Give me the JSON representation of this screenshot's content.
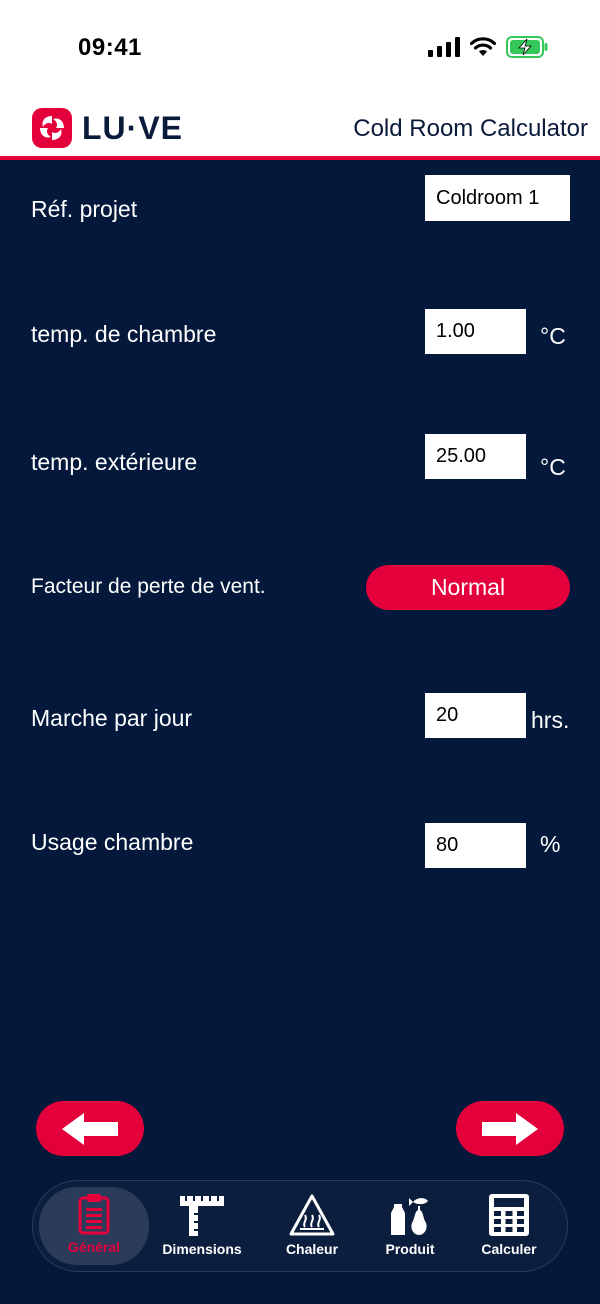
{
  "status": {
    "time": "09:41"
  },
  "header": {
    "brand": "LU·VE",
    "title": "Cold Room Calculator"
  },
  "form": {
    "project_ref": {
      "label": "Réf. projet",
      "value": "Coldroom 1"
    },
    "room_temp": {
      "label": "temp. de chambre",
      "value": "1.00",
      "unit": "°C"
    },
    "ext_temp": {
      "label": "temp. extérieure",
      "value": "25.00",
      "unit": "°C"
    },
    "vent_loss": {
      "label": "Facteur de perte de vent.",
      "value": "Normal"
    },
    "run_per_day": {
      "label": "Marche par jour",
      "value": "20",
      "unit": "hrs."
    },
    "room_usage": {
      "label": "Usage chambre",
      "value": "80",
      "unit": "%"
    }
  },
  "tabs": [
    {
      "label": "Général",
      "icon": "clipboard-icon"
    },
    {
      "label": "Dimensions",
      "icon": "ruler-icon"
    },
    {
      "label": "Chaleur",
      "icon": "heat-warning-icon"
    },
    {
      "label": "Produit",
      "icon": "product-icon"
    },
    {
      "label": "Calculer",
      "icon": "calculator-icon"
    }
  ],
  "colors": {
    "accent": "#e4003b",
    "background": "#03183a",
    "white": "#ffffff"
  }
}
